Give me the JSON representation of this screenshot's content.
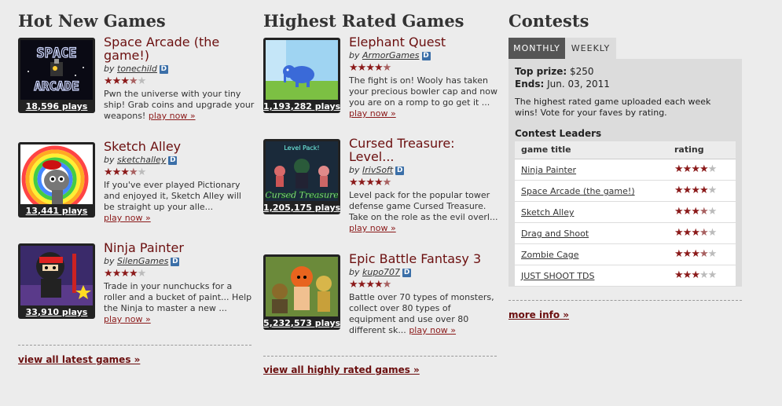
{
  "hot": {
    "heading": "Hot New Games",
    "footer": "view all latest games »",
    "games": [
      {
        "title": "Space Arcade (the game!)",
        "by": "by",
        "author": "tonechild",
        "badge": "D",
        "plays": "18,596 plays",
        "rating": 3.5,
        "desc": "Pwn the universe with your tiny ship! Grab coins and upgrade your weapons!",
        "playnow": "play now »"
      },
      {
        "title": "Sketch Alley",
        "by": "by",
        "author": "sketchalley",
        "badge": "D",
        "plays": "13,441 plays",
        "rating": 3.5,
        "desc": "If you've ever played Pictionary and enjoyed it, Sketch Alley will be straight up your alle...",
        "playnow": "play now »"
      },
      {
        "title": "Ninja Painter",
        "by": "by",
        "author": "SilenGames",
        "badge": "D",
        "plays": "33,910 plays",
        "rating": 4,
        "desc": "Trade in your nunchucks for a roller and a bucket of paint... Help the Ninja to master a new ...",
        "playnow": "play now »"
      }
    ]
  },
  "rated": {
    "heading": "Highest Rated Games",
    "footer": "view all highly rated games »",
    "games": [
      {
        "title": "Elephant Quest",
        "by": "by",
        "author": "ArmorGames",
        "badge": "D",
        "plays": "1,193,282 plays",
        "rating": 4.5,
        "desc": "The fight is on! Wooly has taken your precious bowler cap and now you are on a romp to go get it ...",
        "playnow": "play now »"
      },
      {
        "title": "Cursed Treasure: Level...",
        "by": "by",
        "author": "IrivSoft",
        "badge": "D",
        "plays": "1,205,175 plays",
        "rating": 4.5,
        "desc": "Level pack for the popular tower defense game Cursed Treasure. Take on the role as the evil overl...",
        "playnow": "play now »"
      },
      {
        "title": "Epic Battle Fantasy 3",
        "by": "by",
        "author": "kupo707",
        "badge": "D",
        "plays": "5,232,573 plays",
        "rating": 4.5,
        "desc": "Battle over 70 types of monsters, collect over 80 types of equipment and use over 80 different sk...",
        "playnow": "play now »"
      }
    ]
  },
  "contests": {
    "heading": "Contests",
    "tabs": [
      "MONTHLY",
      "WEEKLY"
    ],
    "active_tab": "MONTHLY",
    "top_prize_label": "Top prize:",
    "top_prize": "$250",
    "ends_label": "Ends:",
    "ends": "Jun. 03, 2011",
    "blurb": "The highest rated game uploaded each week wins! Vote for your faves by rating.",
    "leaders_title": "Contest Leaders",
    "col_title": "game title",
    "col_rating": "rating",
    "leaders": [
      {
        "title": "Ninja Painter",
        "rating": 4
      },
      {
        "title": "Space Arcade (the game!)",
        "rating": 4
      },
      {
        "title": "Sketch Alley",
        "rating": 3.5
      },
      {
        "title": "Drag and Shoot",
        "rating": 3.5
      },
      {
        "title": "Zombie Cage",
        "rating": 3.5
      },
      {
        "title": "JUST SHOOT TDS",
        "rating": 3
      }
    ],
    "more_info": "more info »"
  },
  "colors": {
    "accent": "#6b0f0f",
    "star": "#8b1a1a",
    "badge": "#3b6fa8",
    "background": "#ececec"
  }
}
